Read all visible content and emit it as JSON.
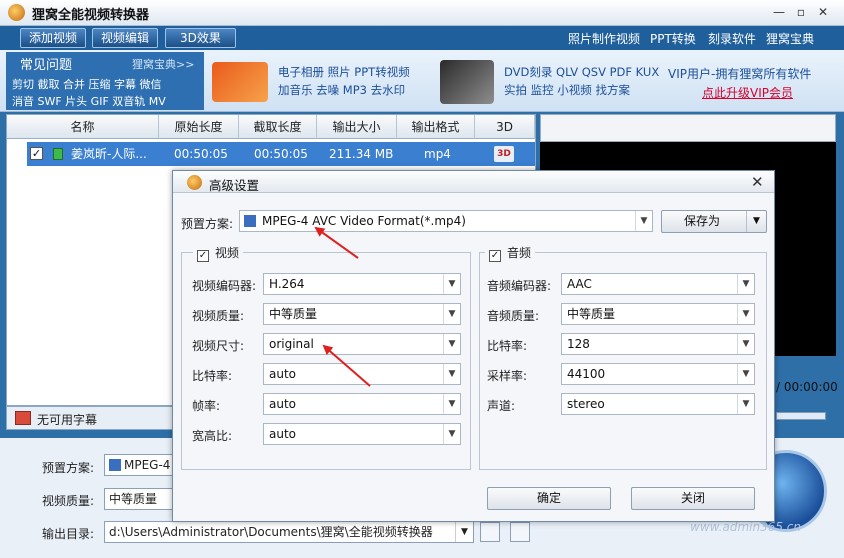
{
  "app": {
    "title": "狸窝全能视频转换器"
  },
  "window_controls": {
    "min": "—",
    "restore": "▫",
    "close": "✕"
  },
  "toolbar": {
    "buttons": [
      "添加视频",
      "视频编辑",
      "3D效果"
    ],
    "links": [
      "照片制作视频",
      "PPT转换",
      "刻录软件",
      "狸窝宝典"
    ]
  },
  "features": {
    "faq_title": "常见问题",
    "faq_more": "狸窝宝典>>",
    "faq_line1": "剪切 截取 合并 压缩 字幕 微信",
    "faq_line2": "消音 SWF 片头 GIF 双音轨 MV",
    "group1_line1": "电子相册 照片 PPT转视频",
    "group1_line2": "加音乐 去噪 MP3 去水印",
    "group2_line1": "DVD刻录 QLV QSV PDF KUX",
    "group2_line2": "实拍 监控 小视频 找方案",
    "vip_text": "VIP用户-拥有狸窝所有软件",
    "vip_link": "点此升级VIP会员"
  },
  "file_list": {
    "columns": [
      "名称",
      "原始长度",
      "截取长度",
      "输出大小",
      "输出格式",
      "3D"
    ],
    "rows": [
      {
        "name": "姜岚昕-人际...",
        "original_length": "00:50:05",
        "cut_length": "00:50:05",
        "output_size": "211.34 MB",
        "format": "mp4",
        "3d": "3D"
      }
    ]
  },
  "preview": {
    "time": "/ 00:00:00"
  },
  "subtitle": {
    "label": "无可用字幕"
  },
  "bottom": {
    "preset_label": "预置方案:",
    "preset_value": "MPEG-4",
    "quality_label": "视频质量:",
    "quality_value": "中等质量",
    "output_label": "输出目录:",
    "output_value": "d:\\Users\\Administrator\\Documents\\狸窝\\全能视频转换器",
    "watermark": "www.admin365.cn"
  },
  "dialog": {
    "title": "高级设置",
    "close": "✕",
    "preset_label": "预置方案:",
    "preset_value": "MPEG-4 AVC Video Format(*.mp4)",
    "save_as": "保存为",
    "video": {
      "title": "视频",
      "fields": [
        {
          "label": "视频编码器:",
          "value": "H.264"
        },
        {
          "label": "视频质量:",
          "value": "中等质量"
        },
        {
          "label": "视频尺寸:",
          "value": "original"
        },
        {
          "label": "比特率:",
          "value": "auto"
        },
        {
          "label": "帧率:",
          "value": "auto"
        },
        {
          "label": "宽高比:",
          "value": "auto"
        }
      ]
    },
    "audio": {
      "title": "音频",
      "fields": [
        {
          "label": "音频编码器:",
          "value": "AAC"
        },
        {
          "label": "音频质量:",
          "value": "中等质量"
        },
        {
          "label": "比特率:",
          "value": "128"
        },
        {
          "label": "采样率:",
          "value": "44100"
        },
        {
          "label": "声道:",
          "value": "stereo"
        }
      ]
    },
    "ok": "确定",
    "cancel": "关闭"
  },
  "colors": {
    "accent": "#2f6fa8",
    "selection": "#3a7fd0",
    "arrow": "#e02020",
    "vip_link": "#d6002b"
  }
}
